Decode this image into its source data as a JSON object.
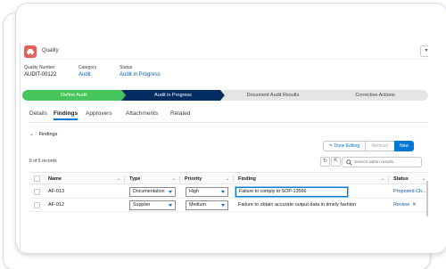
{
  "record": {
    "object_label": "Quality",
    "fields": [
      {
        "label": "Quality Number",
        "value": "AUDIT-00122",
        "link": false
      },
      {
        "label": "Category",
        "value": "Audit",
        "link": true
      },
      {
        "label": "Status",
        "value": "Audit in Progress",
        "link": true
      }
    ]
  },
  "path": {
    "steps": [
      {
        "label": "Define Audit",
        "state": "done"
      },
      {
        "label": "Audit in Progress",
        "state": "current"
      },
      {
        "label": "Document Audit Results",
        "state": "todo"
      },
      {
        "label": "Corrective Actions",
        "state": "todo"
      }
    ]
  },
  "tabs": [
    "Details",
    "Findings",
    "Approvers",
    "Attachments",
    "Related"
  ],
  "active_tab": "Findings",
  "section": {
    "title": "Findings"
  },
  "toolbar": {
    "done_editing": "Done Editing",
    "remove": "Remove",
    "new": "New"
  },
  "list": {
    "count_text": "5 of 5 records",
    "search_placeholder": "Search within results",
    "columns": [
      "Name",
      "Type",
      "Priority",
      "Finding",
      "Status"
    ],
    "rows": [
      {
        "name": "AF-013",
        "type": "Documentation",
        "priority": "High",
        "finding": "Failure to comply to SOP-13566",
        "status": "Proposed Ch...",
        "editing": true
      },
      {
        "name": "AF-012",
        "type": "Supplier",
        "priority": "Medium",
        "finding": "Failure to obtain accurate output data in timely fashion",
        "status": "Review",
        "editing": false
      }
    ]
  },
  "colors": {
    "brand": "#0176d3",
    "path_done": "#45c65a",
    "path_current": "#032d60",
    "object_icon": "#e3615c"
  },
  "icons": [
    "car-icon",
    "chevron-down-icon",
    "refresh-icon",
    "table-settings-icon",
    "search-icon",
    "close-icon",
    "edit-icon"
  ]
}
